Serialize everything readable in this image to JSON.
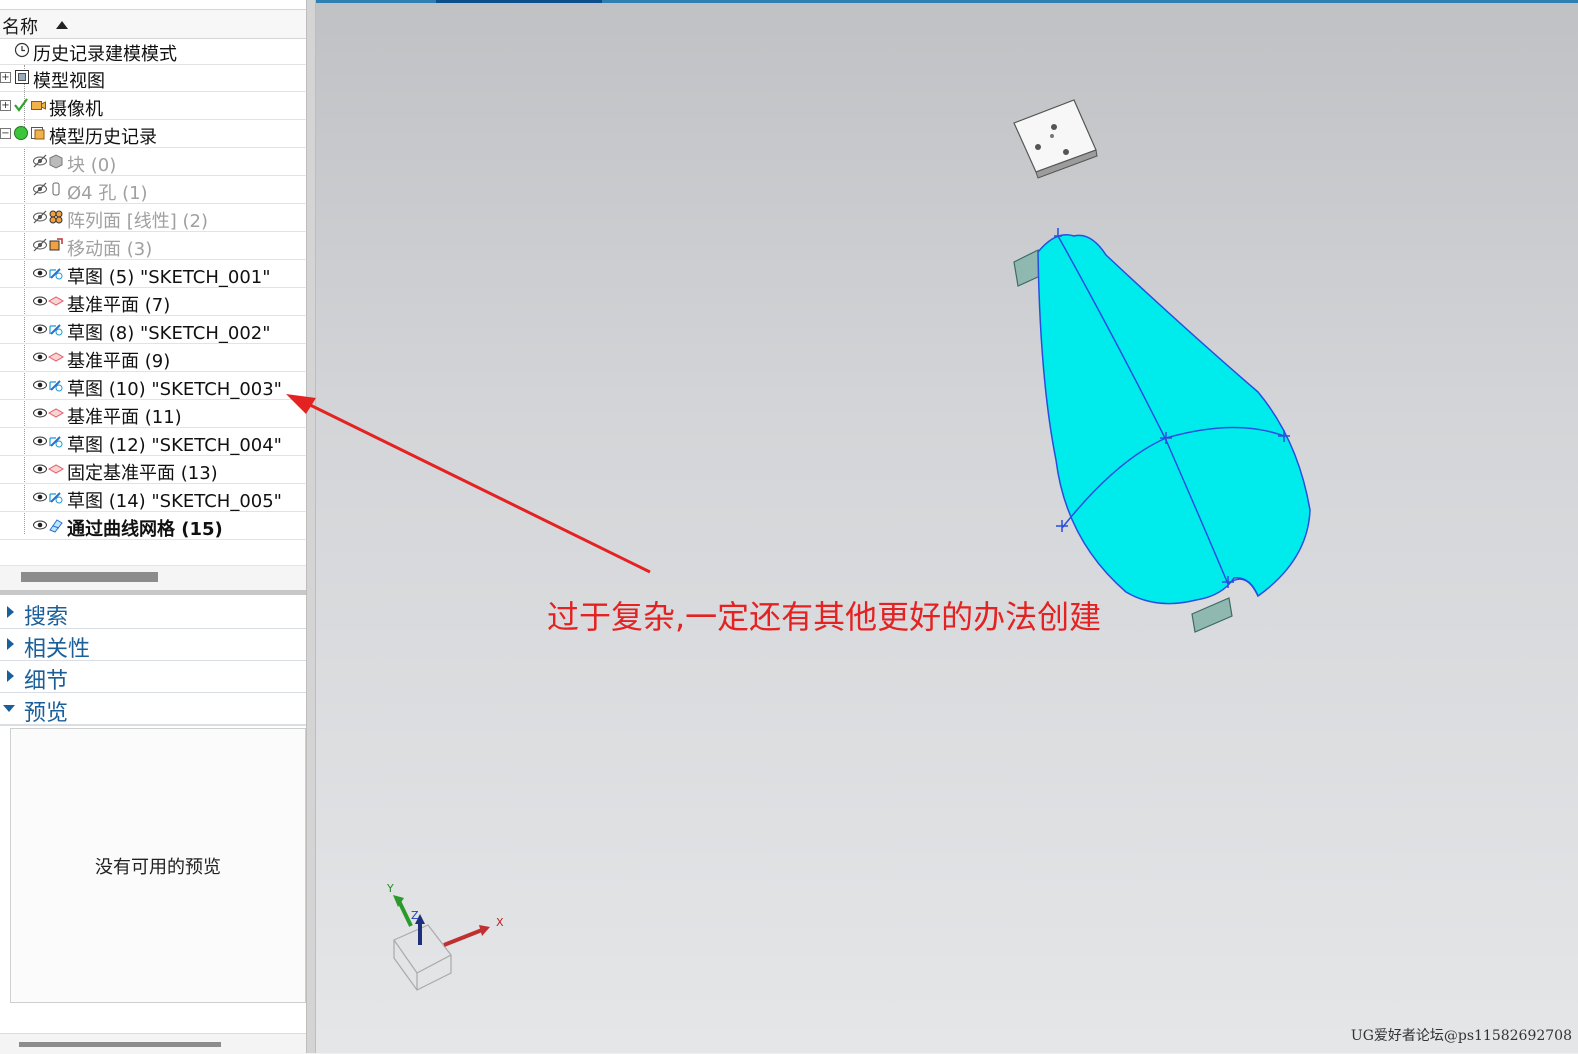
{
  "navigator": {
    "header": {
      "column_title": "名称"
    },
    "tree": [
      {
        "label": "历史记录建模模式",
        "icon": "clock-icon",
        "expander": "",
        "state": "normal"
      },
      {
        "label": "模型视图",
        "icon": "model-view-icon",
        "expander": "+",
        "state": "normal"
      },
      {
        "label": "摄像机",
        "icon": "camera-icon",
        "expander": "+",
        "state": "normal"
      },
      {
        "label": "模型历史记录",
        "icon": "model-history-icon",
        "expander": "−",
        "state": "normal"
      },
      {
        "label": "块 (0)",
        "icon": "block-icon",
        "state": "suppressed"
      },
      {
        "label": "Ø4 孔 (1)",
        "icon": "hole-icon",
        "state": "suppressed"
      },
      {
        "label": "阵列面 [线性] (2)",
        "icon": "pattern-face-icon",
        "state": "suppressed"
      },
      {
        "label": "移动面 (3)",
        "icon": "move-face-icon",
        "state": "suppressed"
      },
      {
        "label": "草图 (5) \"SKETCH_001\"",
        "icon": "sketch-icon",
        "state": "normal"
      },
      {
        "label": "基准平面 (7)",
        "icon": "datum-plane-icon",
        "state": "normal"
      },
      {
        "label": "草图 (8) \"SKETCH_002\"",
        "icon": "sketch-icon",
        "state": "normal"
      },
      {
        "label": "基准平面 (9)",
        "icon": "datum-plane-icon",
        "state": "normal"
      },
      {
        "label": "草图 (10) \"SKETCH_003\"",
        "icon": "sketch-icon",
        "state": "normal"
      },
      {
        "label": "基准平面 (11)",
        "icon": "datum-plane-icon",
        "state": "normal"
      },
      {
        "label": "草图 (12) \"SKETCH_004\"",
        "icon": "sketch-icon",
        "state": "normal"
      },
      {
        "label": "固定基准平面 (13)",
        "icon": "datum-plane-icon",
        "state": "normal"
      },
      {
        "label": "草图 (14) \"SKETCH_005\"",
        "icon": "sketch-icon",
        "state": "normal"
      },
      {
        "label": "通过曲线网格 (15)",
        "icon": "through-curve-mesh-icon",
        "state": "current"
      }
    ],
    "sections": {
      "search": "搜索",
      "dependencies": "相关性",
      "details": "细节",
      "preview": "预览"
    },
    "preview_text": "没有可用的预览"
  },
  "viewport": {
    "annotation": "过于复杂,一定还有其他更好的办法创建",
    "watermark": "UG爱好者论坛@ps11582692708",
    "triad": {
      "x": "X",
      "y": "Y",
      "z": "Z"
    },
    "colors": {
      "surface": "#00ecec",
      "surface_edge": "#2a4de0",
      "annotation": "#e52222"
    }
  }
}
